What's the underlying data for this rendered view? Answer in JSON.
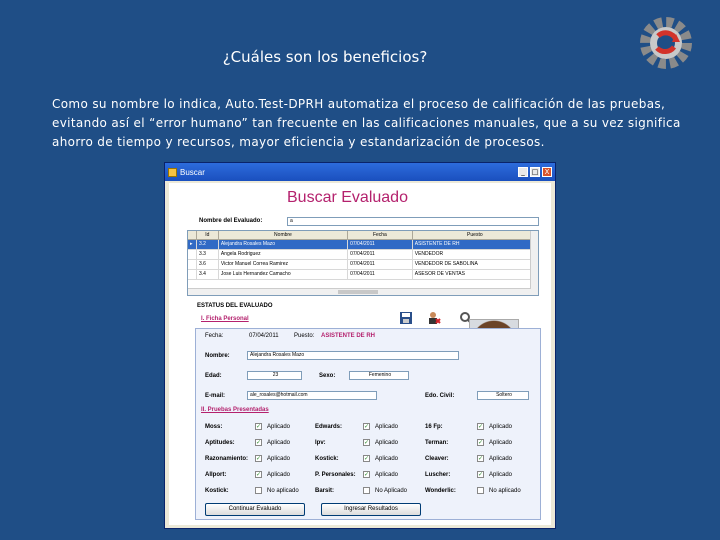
{
  "slide": {
    "title": "¿Cuáles son los beneficios?",
    "paragraph": "Como su nombre lo indica, Auto.Test-DPRH automatiza el proceso de calificación de las pruebas, evitando así el “error humano” tan frecuente en las calificaciones manuales, que a su vez significa ahorro de tiempo y recursos, mayor eficiencia y estandarización de procesos."
  },
  "window": {
    "title": "Buscar",
    "min": "_",
    "max": "□",
    "close": "X",
    "heading": "Buscar Evaluado",
    "search_label": "Nombre del Evaluado:",
    "search_value": "a",
    "grid": {
      "headers": [
        "",
        "Id",
        "Nombre",
        "Fecha",
        "Puesto"
      ],
      "rows": [
        {
          "marker": "▸",
          "id": "3.2",
          "name": "Alejandra Rosales Mazo",
          "date": "07/04/2011",
          "position": "ASISTENTE DE RH"
        },
        {
          "marker": "",
          "id": "3.3",
          "name": "Angela Rodriguez",
          "date": "07/04/2011",
          "position": "VENDEDOR"
        },
        {
          "marker": "",
          "id": "3.6",
          "name": "Victor Manuel Correa Ramirez",
          "date": "07/04/2011",
          "position": "VENDEDOR DE SABOLINA"
        },
        {
          "marker": "",
          "id": "3.4",
          "name": "Jose Luis Hernandez Camacho",
          "date": "07/04/2011",
          "position": "ASESOR DE VENTAS"
        }
      ]
    },
    "status_label": "ESTATUS DEL EVALUADO",
    "personal": {
      "section": "I. Ficha Personal",
      "fecha_label": "Fecha:",
      "fecha_value": "07/04/2011",
      "puesto_label": "Puesto:",
      "puesto_value": "ASISTENTE DE RH",
      "nombre_label": "Nombre:",
      "nombre_value": "Alejandra Rosales Mazo",
      "edad_label": "Edad:",
      "edad_value": "23",
      "sexo_label": "Sexo:",
      "sexo_value": "Femenino",
      "email_label": "E-mail:",
      "email_value": "ale_rosales@hotmail.com",
      "civil_label": "Edo. Civil:",
      "civil_value": "Soltero"
    },
    "tests": {
      "section": "II. Pruebas Presentadas",
      "rows": [
        [
          {
            "name": "Moss:",
            "checked": true,
            "status": "Aplicado"
          },
          {
            "name": "Edwards:",
            "checked": true,
            "status": "Aplicado"
          },
          {
            "name": "16 Fp:",
            "checked": true,
            "status": "Aplicado"
          }
        ],
        [
          {
            "name": "Aptitudes:",
            "checked": true,
            "status": "Aplicado"
          },
          {
            "name": "Ipv:",
            "checked": true,
            "status": "Aplicado"
          },
          {
            "name": "Terman:",
            "checked": true,
            "status": "Aplicado"
          }
        ],
        [
          {
            "name": "Razonamiento:",
            "checked": true,
            "status": "Aplicado"
          },
          {
            "name": "Kostick:",
            "checked": true,
            "status": "Aplicado"
          },
          {
            "name": "Cleaver:",
            "checked": true,
            "status": "Aplicado"
          }
        ],
        [
          {
            "name": "Allport:",
            "checked": true,
            "status": "Aplicado"
          },
          {
            "name": "P. Personales:",
            "checked": true,
            "status": "Aplicado"
          },
          {
            "name": "Luscher:",
            "checked": true,
            "status": "Aplicado"
          }
        ],
        [
          {
            "name": "Kostick:",
            "checked": false,
            "status": "No aplicado"
          },
          {
            "name": "Barsit:",
            "checked": false,
            "status": "No Aplicado"
          },
          {
            "name": "Wonderlic:",
            "checked": false,
            "status": "No aplicado"
          }
        ]
      ]
    },
    "buttons": {
      "continue": "Continuar Evaluado",
      "enter": "Ingresar Resultados"
    }
  }
}
